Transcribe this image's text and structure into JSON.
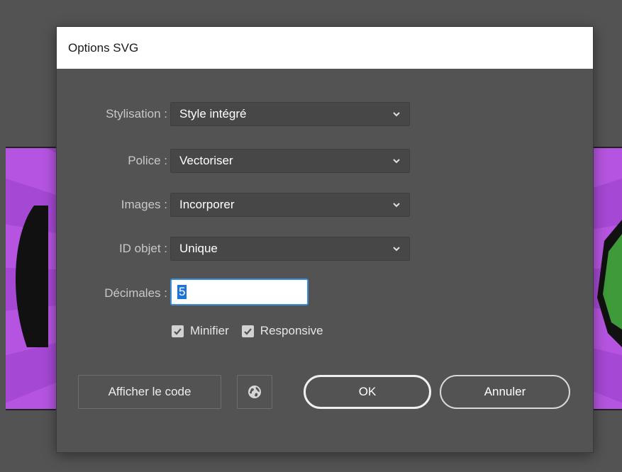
{
  "dialog": {
    "title": "Options SVG"
  },
  "fields": {
    "stylisation": {
      "label": "Stylisation :",
      "value": "Style intégré"
    },
    "police": {
      "label": "Police :",
      "value": "Vectoriser"
    },
    "images": {
      "label": "Images :",
      "value": "Incorporer"
    },
    "id_objet": {
      "label": "ID objet :",
      "value": "Unique"
    },
    "decimales": {
      "label": "Décimales :",
      "value": "5"
    }
  },
  "checkboxes": {
    "minifier": {
      "label": "Minifier",
      "checked": true
    },
    "responsive": {
      "label": "Responsive",
      "checked": true
    }
  },
  "buttons": {
    "show_code": "Afficher le code",
    "ok": "OK",
    "cancel": "Annuler"
  },
  "icons": {
    "web": "globe-icon",
    "dropdown": "chevron-down-icon",
    "check": "checkmark-icon"
  },
  "colors": {
    "dialog_bg": "#535353",
    "title_bg": "#ffffff",
    "artwork_purple": "#b554e0",
    "input_focus": "#3d8fd9"
  }
}
